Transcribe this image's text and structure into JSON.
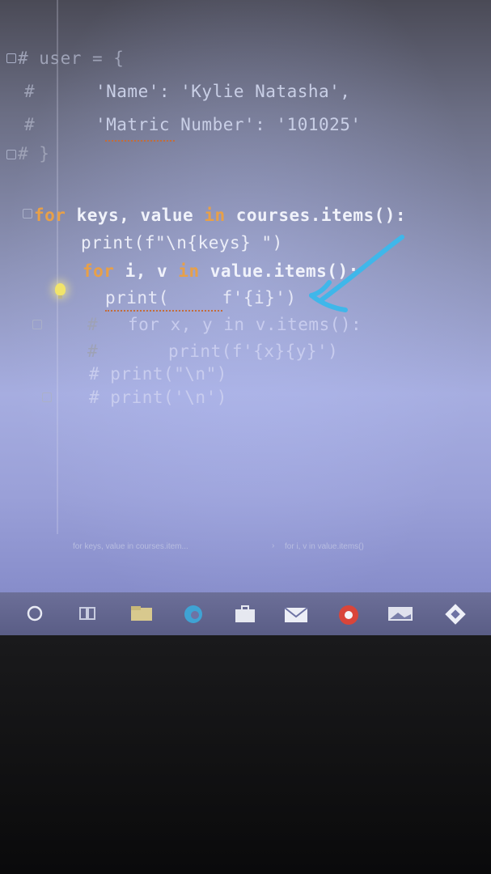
{
  "editor": {
    "line1": "# user = {",
    "line2_hash": "#",
    "line2_text": "'Name': 'Kylie Natasha',",
    "line3_hash": "#",
    "line3_text": "'Matric Number': '101025'",
    "line4": "# }",
    "line5_kw1": "for",
    "line5_a": " keys, value ",
    "line5_kw2": "in",
    "line5_b": " courses.items():",
    "line6": "print(f\"\\n{keys} \")",
    "line7_kw1": "for",
    "line7_a": " i, v ",
    "line7_kw2": "in",
    "line7_b": " value.items():",
    "line8": "print(     f'{i}')",
    "line9_hash": "#",
    "line9_text": "for x, y in v.items():",
    "line10_hash": "#",
    "line10_text": "print(f'{x}{y}')",
    "line11": "# print(\"\\n\")",
    "line12": "# print('\\n')"
  },
  "breadcrumb": {
    "item1": "for keys, value in courses.item...",
    "item2": "for i, v in value.items()"
  },
  "colors": {
    "keyword": "#e8a048",
    "arrow": "#3fb7ea"
  },
  "taskbar": {
    "icons": [
      "start-circle-icon",
      "task-view-icon",
      "file-explorer-icon",
      "edge-icon",
      "store-icon",
      "mail-icon",
      "chrome-icon",
      "photos-icon",
      "pycharm-icon"
    ]
  }
}
